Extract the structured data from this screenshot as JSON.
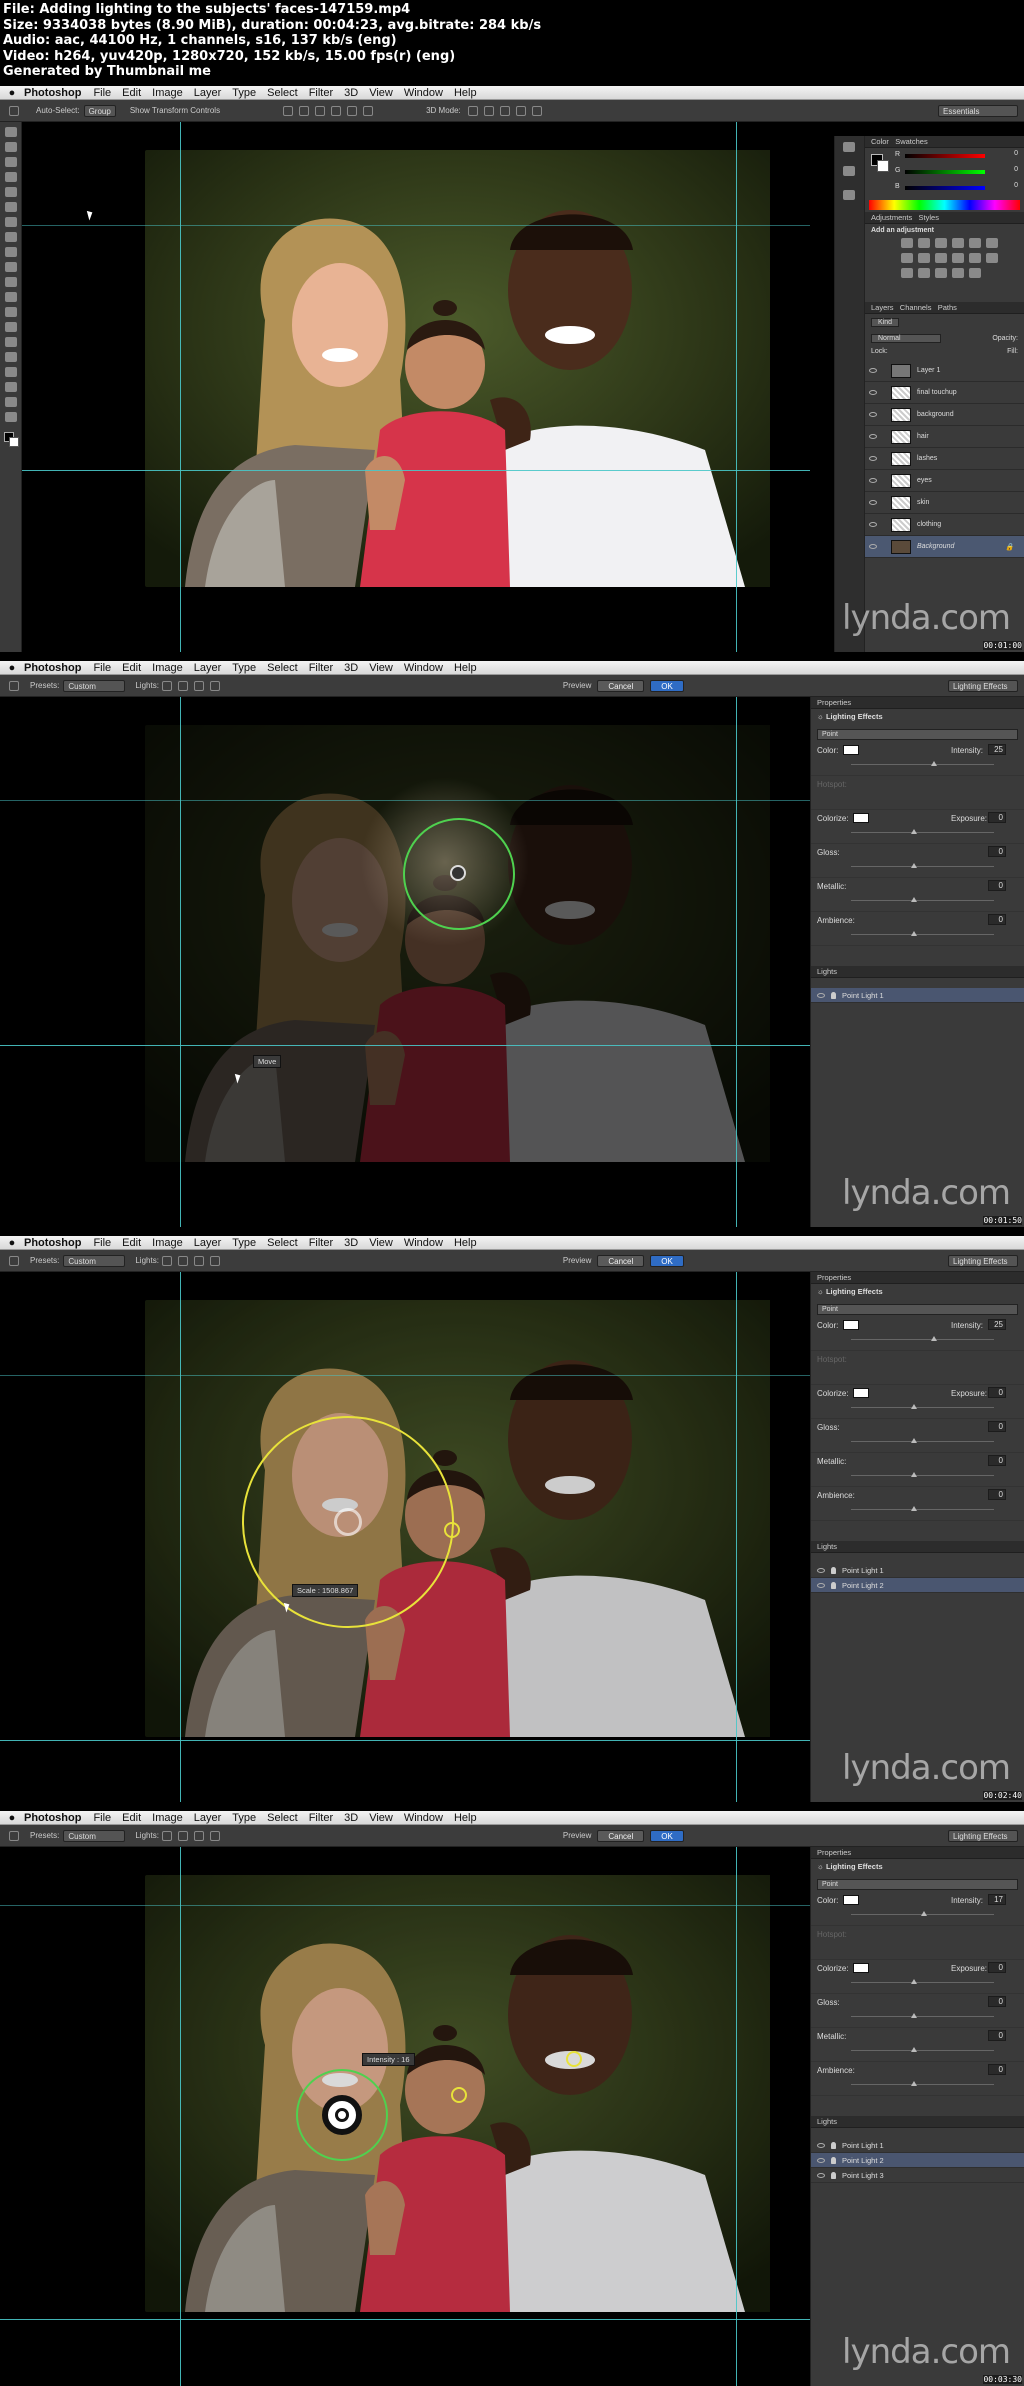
{
  "header": {
    "line1": "File: Adding lighting to the subjects' faces-147159.mp4",
    "line2": "Size: 9334038 bytes (8.90 MiB), duration: 00:04:23, avg.bitrate: 284 kb/s",
    "line3": "Audio: aac, 44100 Hz, 1 channels, s16, 137 kb/s (eng)",
    "line4": "Video: h264, yuv420p, 1280x720, 152 kb/s, 15.00 fps(r) (eng)",
    "line5": "Generated by Thumbnail me"
  },
  "menu": {
    "app": "Photoshop",
    "items": [
      "File",
      "Edit",
      "Image",
      "Layer",
      "Type",
      "Select",
      "Filter",
      "3D",
      "View",
      "Window",
      "Help"
    ]
  },
  "frame1": {
    "options": {
      "auto_select": "Auto-Select:",
      "group": "Group",
      "show_transform": "Show Transform Controls",
      "mode3d": "3D Mode:",
      "workspace": "Essentials"
    },
    "panels": {
      "color": "Color",
      "swatches": "Swatches",
      "adjustments": "Adjustments",
      "styles": "Styles",
      "add_adjustment": "Add an adjustment",
      "layers": "Layers",
      "channels": "Channels",
      "paths": "Paths",
      "kind": "Kind",
      "normal": "Normal",
      "opacity": "Opacity:",
      "lock": "Lock:",
      "fill": "Fill:",
      "r": "R",
      "g": "G",
      "b": "B",
      "r_val": "0",
      "g_val": "0",
      "b_val": "0"
    },
    "layers": [
      "Layer 1",
      "final touchup",
      "background",
      "hair",
      "lashes",
      "eyes",
      "skin",
      "clothing",
      "Background"
    ],
    "timestamp": "00:01:00"
  },
  "lighting": {
    "presets": "Presets:",
    "custom": "Custom",
    "lights": "Lights:",
    "preview": "Preview",
    "cancel": "Cancel",
    "ok": "OK",
    "workspace": "Lighting Effects",
    "properties": "Properties",
    "effect_title": "Lighting Effects",
    "type": "Point",
    "color": "Color:",
    "intensity": "Intensity:",
    "hotspot": "Hotspot:",
    "colorize": "Colorize:",
    "exposure": "Exposure:",
    "gloss": "Gloss:",
    "metallic": "Metallic:",
    "ambience": "Ambience:",
    "lights_title": "Lights"
  },
  "frame2": {
    "intensity": "25",
    "exposure": "0",
    "gloss": "0",
    "metallic": "0",
    "ambience": "0",
    "lights": [
      "Point Light 1"
    ],
    "tip": "Move",
    "timestamp": "00:01:50"
  },
  "frame3": {
    "intensity": "25",
    "exposure": "0",
    "gloss": "0",
    "metallic": "0",
    "ambience": "0",
    "lights": [
      "Point Light 1",
      "Point Light 2"
    ],
    "tip": "Scale : 1508.867",
    "timestamp": "00:02:40"
  },
  "frame4": {
    "intensity": "17",
    "exposure": "0",
    "gloss": "0",
    "metallic": "0",
    "ambience": "0",
    "lights": [
      "Point Light 1",
      "Point Light 2",
      "Point Light 3"
    ],
    "tip": "Intensity : 16",
    "timestamp": "00:03:30"
  },
  "watermark": "lynda.com",
  "colors": {
    "guide": "#49c6c8",
    "green_ring": "#4fd14f",
    "yellow_ring": "#e8e23a",
    "shirt_red": "#d6344a",
    "bg_green": "#3c4a22"
  }
}
